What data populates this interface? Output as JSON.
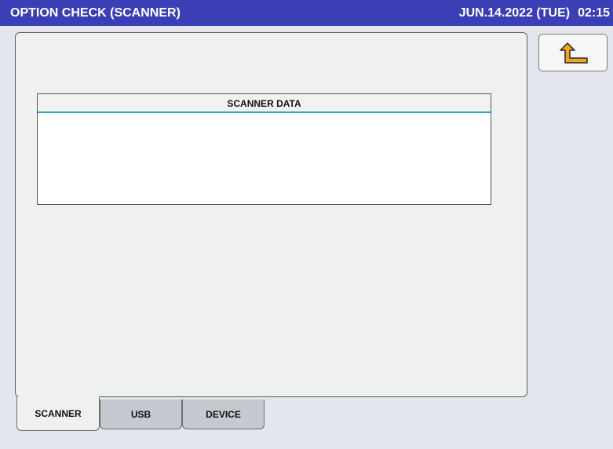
{
  "header": {
    "title": "OPTION CHECK (SCANNER)",
    "date": "JUN.14.2022 (TUE)",
    "time": "02:15"
  },
  "scanner_data": {
    "title": "SCANNER DATA",
    "content": ""
  },
  "back_button": {
    "icon": "back-arrow-icon"
  },
  "tabs": [
    {
      "label": "SCANNER",
      "active": true
    },
    {
      "label": "USB",
      "active": false
    },
    {
      "label": "DEVICE",
      "active": false
    }
  ],
  "colors": {
    "title_bar": "#3a3fb5",
    "accent_line": "#2fa6bf",
    "icon_fill": "#f0a420"
  }
}
